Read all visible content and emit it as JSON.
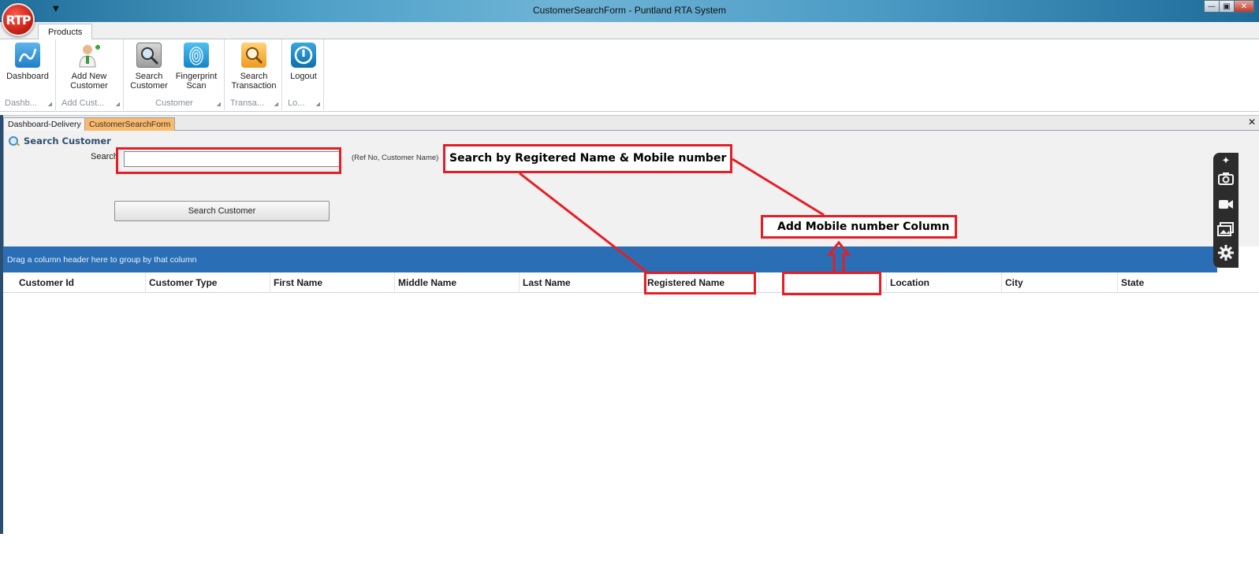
{
  "window": {
    "title": "CustomerSearchForm - Puntland RTA System",
    "logo_text": "RTP",
    "controls": {
      "minimize": "—",
      "maximize": "▣",
      "close": "✕"
    }
  },
  "ribbon": {
    "tab": "Products",
    "buttons": [
      {
        "label": "Dashboard",
        "icon": "dashboard-icon"
      },
      {
        "label": "Add New Customer",
        "icon": "add-user-icon"
      },
      {
        "label": "Search Customer",
        "icon": "search-customer-icon"
      },
      {
        "label": "Fingerprint Scan",
        "icon": "fingerprint-icon"
      },
      {
        "label": "Search Transaction",
        "icon": "search-transaction-icon"
      },
      {
        "label": "Logout",
        "icon": "logout-icon"
      }
    ],
    "groups": [
      "Dashb...",
      "Add Cust...",
      "Customer",
      "Transa...",
      "Lo..."
    ]
  },
  "doc_tabs": [
    "Dashboard-Delivery",
    "CustomerSearchForm"
  ],
  "doc_close": "✕",
  "search": {
    "title": "Search Customer",
    "label": "Search",
    "value": "",
    "hint": "(Ref No, Customer Name)",
    "button": "Search Customer"
  },
  "grid": {
    "group_panel_text": "Drag a column header here to group by that column",
    "columns": [
      "Customer Id",
      "Customer Type",
      "First Name",
      "Middle Name",
      "Last Name",
      "Registered Name",
      "",
      "Location",
      "City",
      "State"
    ]
  },
  "annotations": {
    "search_note": "Search by Regitered Name & Mobile number",
    "column_note": "Add Mobile number Column"
  },
  "side_tools": [
    "pin-icon",
    "camera-icon",
    "video-icon",
    "gallery-icon",
    "settings-icon"
  ],
  "colors": {
    "annotation_red": "#e51e26",
    "group_panel_blue": "#2a6fb5",
    "active_tab_orange": "#fbb96b"
  }
}
